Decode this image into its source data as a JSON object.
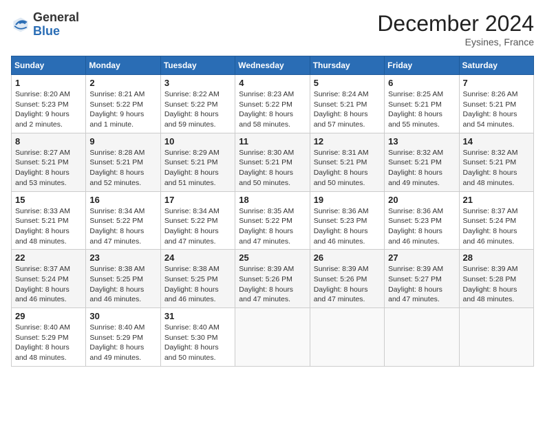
{
  "header": {
    "logo_general": "General",
    "logo_blue": "Blue",
    "month_title": "December 2024",
    "location": "Eysines, France"
  },
  "days_of_week": [
    "Sunday",
    "Monday",
    "Tuesday",
    "Wednesday",
    "Thursday",
    "Friday",
    "Saturday"
  ],
  "weeks": [
    [
      {
        "day": "1",
        "detail": "Sunrise: 8:20 AM\nSunset: 5:23 PM\nDaylight: 9 hours\nand 2 minutes."
      },
      {
        "day": "2",
        "detail": "Sunrise: 8:21 AM\nSunset: 5:22 PM\nDaylight: 9 hours\nand 1 minute."
      },
      {
        "day": "3",
        "detail": "Sunrise: 8:22 AM\nSunset: 5:22 PM\nDaylight: 8 hours\nand 59 minutes."
      },
      {
        "day": "4",
        "detail": "Sunrise: 8:23 AM\nSunset: 5:22 PM\nDaylight: 8 hours\nand 58 minutes."
      },
      {
        "day": "5",
        "detail": "Sunrise: 8:24 AM\nSunset: 5:21 PM\nDaylight: 8 hours\nand 57 minutes."
      },
      {
        "day": "6",
        "detail": "Sunrise: 8:25 AM\nSunset: 5:21 PM\nDaylight: 8 hours\nand 55 minutes."
      },
      {
        "day": "7",
        "detail": "Sunrise: 8:26 AM\nSunset: 5:21 PM\nDaylight: 8 hours\nand 54 minutes."
      }
    ],
    [
      {
        "day": "8",
        "detail": "Sunrise: 8:27 AM\nSunset: 5:21 PM\nDaylight: 8 hours\nand 53 minutes."
      },
      {
        "day": "9",
        "detail": "Sunrise: 8:28 AM\nSunset: 5:21 PM\nDaylight: 8 hours\nand 52 minutes."
      },
      {
        "day": "10",
        "detail": "Sunrise: 8:29 AM\nSunset: 5:21 PM\nDaylight: 8 hours\nand 51 minutes."
      },
      {
        "day": "11",
        "detail": "Sunrise: 8:30 AM\nSunset: 5:21 PM\nDaylight: 8 hours\nand 50 minutes."
      },
      {
        "day": "12",
        "detail": "Sunrise: 8:31 AM\nSunset: 5:21 PM\nDaylight: 8 hours\nand 50 minutes."
      },
      {
        "day": "13",
        "detail": "Sunrise: 8:32 AM\nSunset: 5:21 PM\nDaylight: 8 hours\nand 49 minutes."
      },
      {
        "day": "14",
        "detail": "Sunrise: 8:32 AM\nSunset: 5:21 PM\nDaylight: 8 hours\nand 48 minutes."
      }
    ],
    [
      {
        "day": "15",
        "detail": "Sunrise: 8:33 AM\nSunset: 5:21 PM\nDaylight: 8 hours\nand 48 minutes."
      },
      {
        "day": "16",
        "detail": "Sunrise: 8:34 AM\nSunset: 5:22 PM\nDaylight: 8 hours\nand 47 minutes."
      },
      {
        "day": "17",
        "detail": "Sunrise: 8:34 AM\nSunset: 5:22 PM\nDaylight: 8 hours\nand 47 minutes."
      },
      {
        "day": "18",
        "detail": "Sunrise: 8:35 AM\nSunset: 5:22 PM\nDaylight: 8 hours\nand 47 minutes."
      },
      {
        "day": "19",
        "detail": "Sunrise: 8:36 AM\nSunset: 5:23 PM\nDaylight: 8 hours\nand 46 minutes."
      },
      {
        "day": "20",
        "detail": "Sunrise: 8:36 AM\nSunset: 5:23 PM\nDaylight: 8 hours\nand 46 minutes."
      },
      {
        "day": "21",
        "detail": "Sunrise: 8:37 AM\nSunset: 5:24 PM\nDaylight: 8 hours\nand 46 minutes."
      }
    ],
    [
      {
        "day": "22",
        "detail": "Sunrise: 8:37 AM\nSunset: 5:24 PM\nDaylight: 8 hours\nand 46 minutes."
      },
      {
        "day": "23",
        "detail": "Sunrise: 8:38 AM\nSunset: 5:25 PM\nDaylight: 8 hours\nand 46 minutes."
      },
      {
        "day": "24",
        "detail": "Sunrise: 8:38 AM\nSunset: 5:25 PM\nDaylight: 8 hours\nand 46 minutes."
      },
      {
        "day": "25",
        "detail": "Sunrise: 8:39 AM\nSunset: 5:26 PM\nDaylight: 8 hours\nand 47 minutes."
      },
      {
        "day": "26",
        "detail": "Sunrise: 8:39 AM\nSunset: 5:26 PM\nDaylight: 8 hours\nand 47 minutes."
      },
      {
        "day": "27",
        "detail": "Sunrise: 8:39 AM\nSunset: 5:27 PM\nDaylight: 8 hours\nand 47 minutes."
      },
      {
        "day": "28",
        "detail": "Sunrise: 8:39 AM\nSunset: 5:28 PM\nDaylight: 8 hours\nand 48 minutes."
      }
    ],
    [
      {
        "day": "29",
        "detail": "Sunrise: 8:40 AM\nSunset: 5:29 PM\nDaylight: 8 hours\nand 48 minutes."
      },
      {
        "day": "30",
        "detail": "Sunrise: 8:40 AM\nSunset: 5:29 PM\nDaylight: 8 hours\nand 49 minutes."
      },
      {
        "day": "31",
        "detail": "Sunrise: 8:40 AM\nSunset: 5:30 PM\nDaylight: 8 hours\nand 50 minutes."
      },
      {
        "day": "",
        "detail": ""
      },
      {
        "day": "",
        "detail": ""
      },
      {
        "day": "",
        "detail": ""
      },
      {
        "day": "",
        "detail": ""
      }
    ]
  ]
}
